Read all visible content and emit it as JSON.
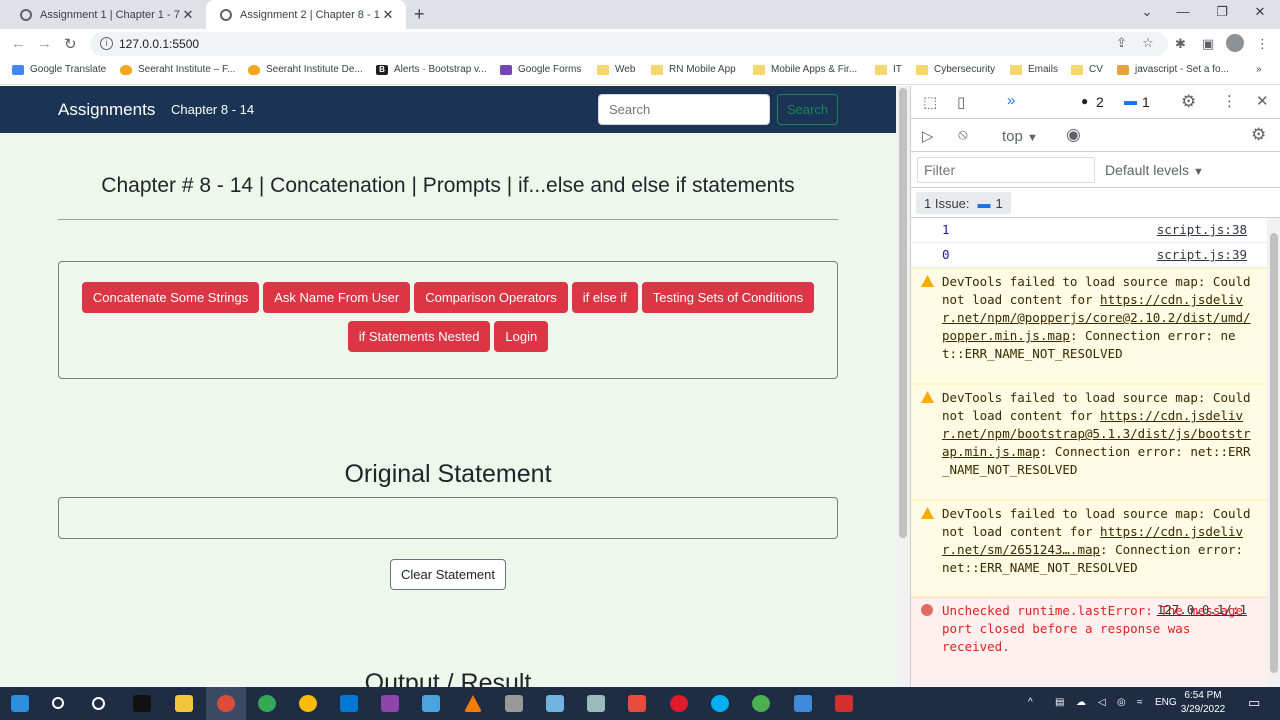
{
  "browser": {
    "tabs": [
      {
        "title": "Assignment 1 | Chapter 1 - 7",
        "active": false
      },
      {
        "title": "Assignment 2 | Chapter 8 - 14",
        "active": true
      }
    ],
    "url": "127.0.0.1:5500",
    "bookmarks": [
      {
        "label": "Google Translate",
        "icon": "google-translate-icon"
      },
      {
        "label": "Seeraht Institute – F...",
        "icon": "firebase-icon"
      },
      {
        "label": "Seeraht Institute De...",
        "icon": "firebase-icon"
      },
      {
        "label": "Alerts · Bootstrap v...",
        "icon": "bootstrap-icon"
      },
      {
        "label": "Google Forms",
        "icon": "google-forms-icon"
      },
      {
        "label": "Web",
        "icon": "folder-icon"
      },
      {
        "label": "RN Mobile App",
        "icon": "folder-icon"
      },
      {
        "label": "Mobile Apps & Fir...",
        "icon": "folder-icon"
      },
      {
        "label": "IT",
        "icon": "folder-icon"
      },
      {
        "label": "Cybersecurity",
        "icon": "folder-icon"
      },
      {
        "label": "Emails",
        "icon": "folder-icon"
      },
      {
        "label": "CV",
        "icon": "folder-icon"
      },
      {
        "label": "javascript - Set a fo...",
        "icon": "javascript-icon"
      }
    ]
  },
  "page": {
    "brand": "Assignments",
    "nav_link": "Chapter 8 - 14",
    "search_placeholder": "Search",
    "search_button": "Search",
    "title": "Chapter # 8 - 14 | Concatenation | Prompts | if...else and else if statements",
    "buttons_row1": [
      "Concatenate Some Strings",
      "Ask Name From User",
      "Comparison Operators",
      "if else if",
      "Testing Sets of Conditions"
    ],
    "buttons_row2": [
      "if Statements Nested",
      "Login"
    ],
    "original_statement_heading": "Original Statement",
    "clear_button": "Clear Statement",
    "output_heading": "Output / Result"
  },
  "devtools": {
    "errors_count": "2",
    "messages_count": "1",
    "context": "top",
    "filter_placeholder": "Filter",
    "levels": "Default levels",
    "issues_label": "1 Issue:",
    "issues_count": "1",
    "logs": [
      {
        "value": "1",
        "source": "script.js:38"
      },
      {
        "value": "0",
        "source": "script.js:39"
      }
    ],
    "warnings": [
      {
        "prefix": "DevTools failed to load source map: Could not load content for ",
        "link": "https://cdn.jsdelivr.net/npm/@popperjs/core@2.10.2/dist/umd/popper.min.js.map",
        "suffix": ": Connection error: net::ERR_NAME_NOT_RESOLVED"
      },
      {
        "prefix": "DevTools failed to load source map: Could not load content for ",
        "link": "https://cdn.jsdelivr.net/npm/bootstrap@5.1.3/dist/js/bootstrap.min.js.map",
        "suffix": ": Connection error: net::ERR_NAME_NOT_RESOLVED"
      },
      {
        "prefix": "DevTools failed to load source map: Could not load content for ",
        "link": "https://cdn.jsdelivr.net/sm/2651243….map",
        "suffix": ": Connection error: net::ERR_NAME_NOT_RESOLVED"
      }
    ],
    "error": {
      "message": "Unchecked runtime.lastError: The message port closed before a response was received.",
      "source": "127.0.0.1/:1"
    }
  },
  "taskbar": {
    "language": "ENG",
    "time": "6:54 PM",
    "date": "3/29/2022"
  },
  "colors": {
    "navbar": "#1b3354",
    "page_bg": "#eff7ec",
    "danger": "#dc3545",
    "success": "#198754",
    "taskbar": "#1f2d44"
  }
}
